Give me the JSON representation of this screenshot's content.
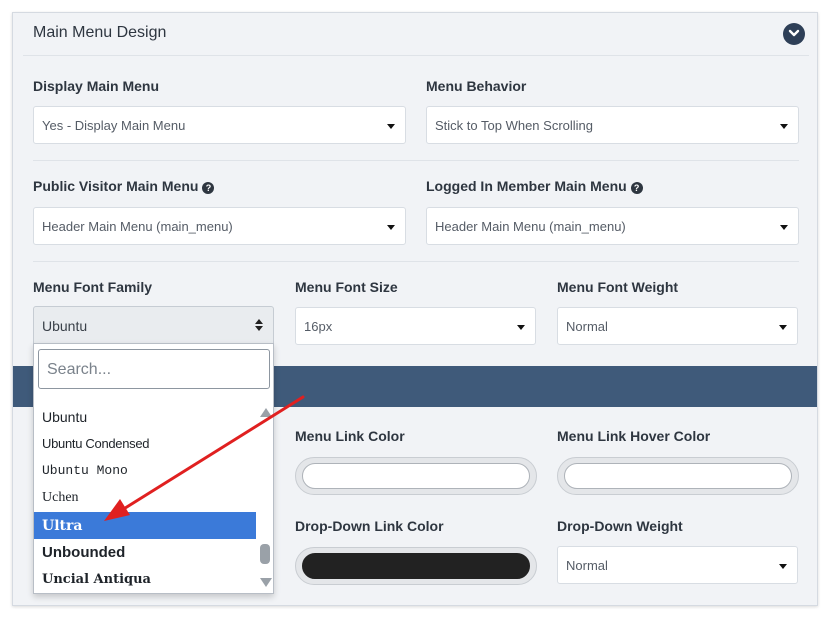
{
  "panel": {
    "title": "Main Menu Design"
  },
  "fields": {
    "display_main_menu": {
      "label": "Display Main Menu",
      "value": "Yes - Display Main Menu"
    },
    "menu_behavior": {
      "label": "Menu Behavior",
      "value": "Stick to Top When Scrolling"
    },
    "public_visitor_menu": {
      "label": "Public Visitor Main Menu",
      "value": "Header Main Menu (main_menu)"
    },
    "logged_in_menu": {
      "label": "Logged In Member Main Menu",
      "value": "Header Main Menu (main_menu)"
    },
    "menu_font_family": {
      "label": "Menu Font Family",
      "value": "Ubuntu"
    },
    "menu_font_size": {
      "label": "Menu Font Size",
      "value": "16px"
    },
    "menu_font_weight": {
      "label": "Menu Font Weight",
      "value": "Normal"
    },
    "menu_link_color": {
      "label": "Menu Link Color",
      "value": "",
      "color": "#ffffff"
    },
    "menu_link_hover_color": {
      "label": "Menu Link Hover Color",
      "value": "",
      "color": "#ffffff"
    },
    "dropdown_link_color": {
      "label": "Drop-Down Link Color",
      "value": "",
      "color": "#222222"
    },
    "dropdown_weight": {
      "label": "Drop-Down Weight",
      "value": "Normal"
    }
  },
  "font_dropdown": {
    "search_placeholder": "Search...",
    "options": [
      "Ubuntu",
      "Ubuntu Condensed",
      "Ubuntu Mono",
      "Uchen",
      "Ultra",
      "Unbounded",
      "Uncial Antiqua"
    ],
    "selected": "Ultra"
  },
  "colors": {
    "accent_band": "#3f5a7a",
    "selected_option": "#3b7ad9",
    "annotation_arrow": "#e02020",
    "collapse_button": "#2e3f57"
  },
  "icons": {
    "help": "question-circle-icon",
    "collapse": "chevron-down-circle-icon"
  }
}
